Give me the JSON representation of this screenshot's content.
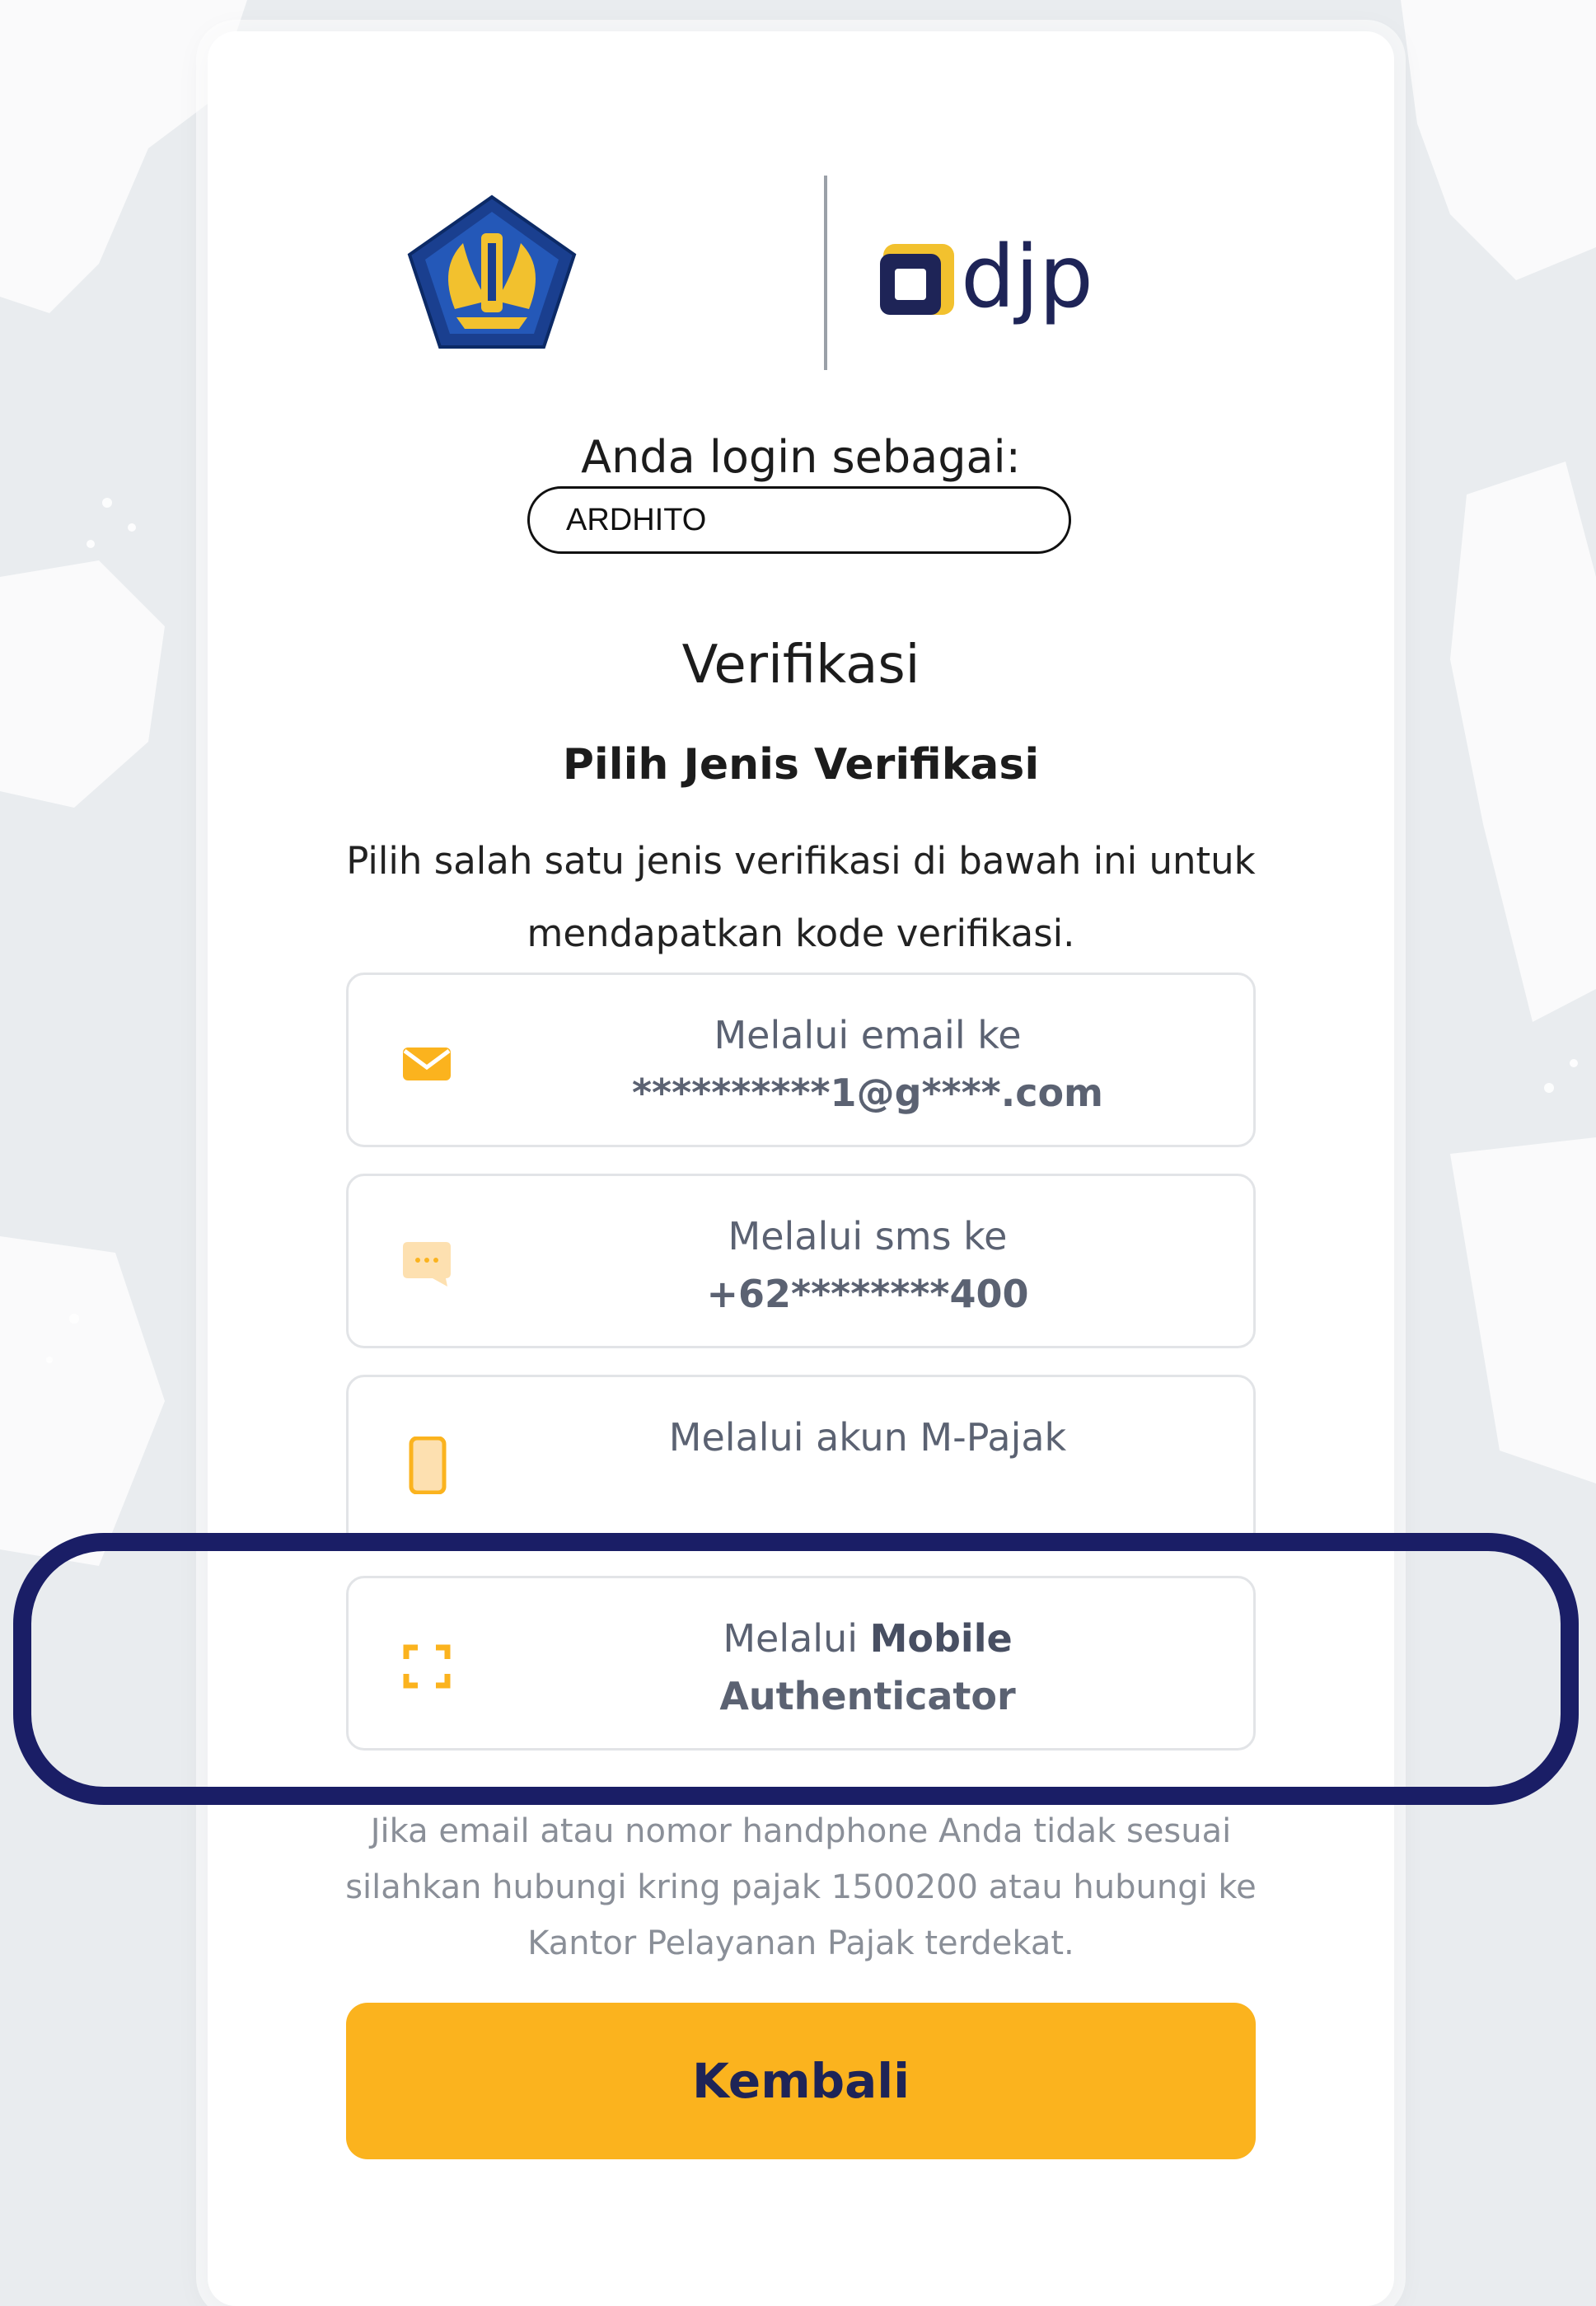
{
  "login_label": "Anda login sebagai:",
  "username": "ARDHITO",
  "title": "Verifikasi",
  "subtitle": "Pilih Jenis Verifikasi",
  "description": "Pilih salah satu jenis verifikasi di bawah ini untuk mendapatkan kode verifikasi.",
  "brand": {
    "logo_text": "djp",
    "accent_color": "#fbb31e",
    "navy_color": "#1e2457"
  },
  "options": [
    {
      "icon": "envelope-icon",
      "line1": "Melalui email ke",
      "line2": "**********1@g****.com"
    },
    {
      "icon": "chat-bubble-icon",
      "line1": "Melalui sms ke",
      "line2": "+62********400"
    },
    {
      "icon": "smartphone-icon",
      "line1": "Melalui akun M-Pajak",
      "line2": ""
    },
    {
      "icon": "scan-frame-icon",
      "line1_prefix": "Melalui ",
      "line1_bold": "Mobile",
      "line2": "Authenticator"
    }
  ],
  "help_text": {
    "line1": "Jika email atau nomor handphone Anda tidak sesuai",
    "line2": "silahkan hubungi kring pajak 1500200 atau hubungi ke",
    "line3": "Kantor Pelayanan Pajak terdekat."
  },
  "back_button": "Kembali",
  "annotation_color": "#1a1e66"
}
